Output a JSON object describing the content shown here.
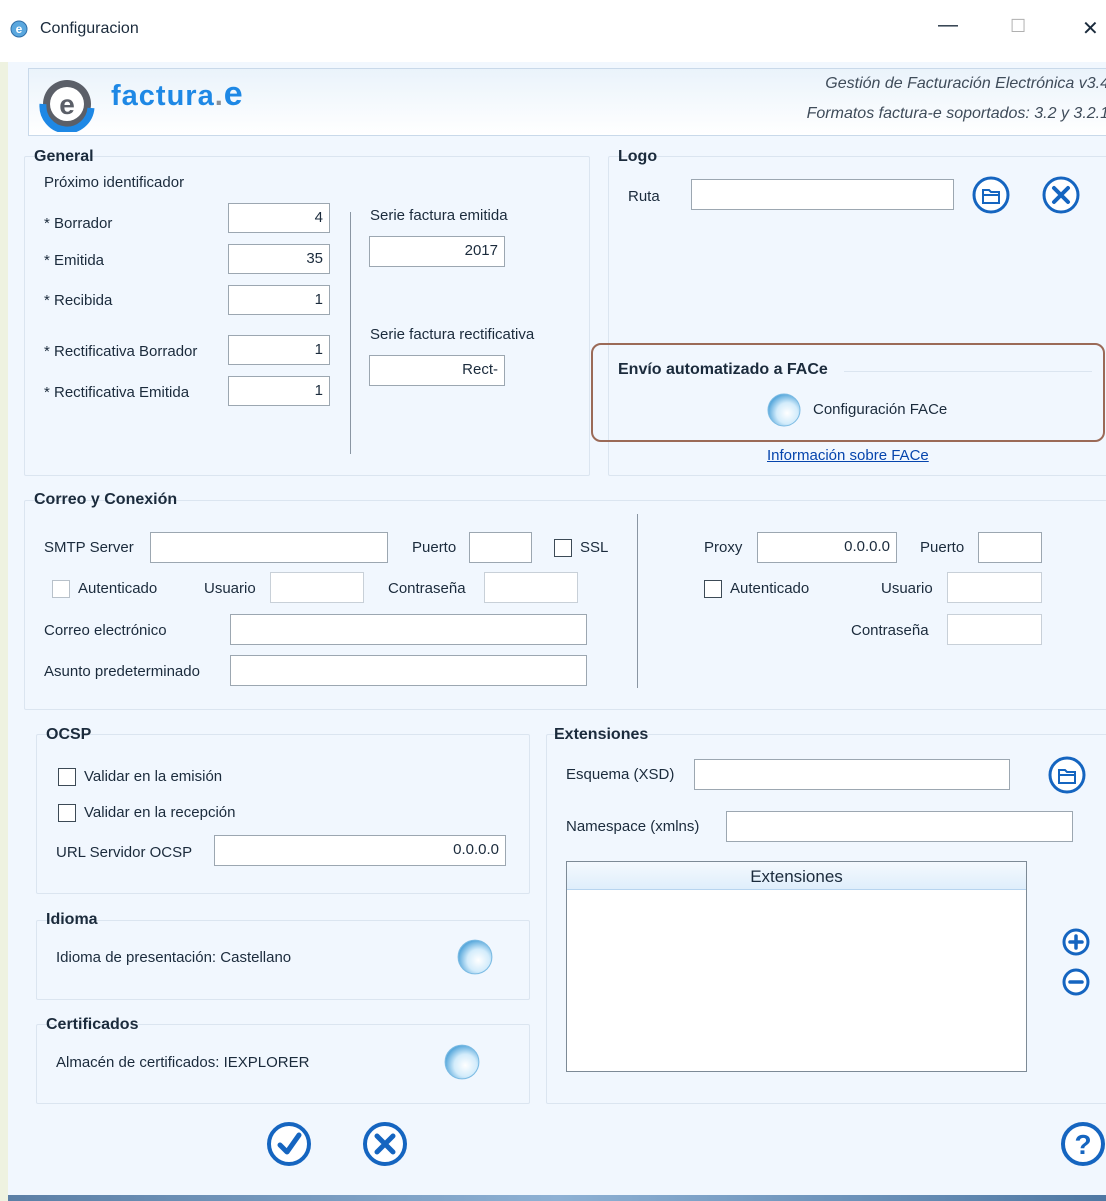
{
  "window": {
    "title": "Configuracion",
    "minimize": "—",
    "maximize": "☐",
    "close": "✕"
  },
  "header": {
    "logo_text": "factura",
    "logo_dot": ".",
    "logo_e": "e",
    "line1": "Gestión de Facturación Electrónica v3.4",
    "line2": "Formatos factura-e soportados: 3.2 y 3.2.1"
  },
  "general": {
    "title": "General",
    "next_id_label": "Próximo identificador",
    "fields": [
      {
        "label": "* Borrador",
        "value": "4"
      },
      {
        "label": "* Emitida",
        "value": "35"
      },
      {
        "label": "* Recibida",
        "value": "1"
      },
      {
        "label": "* Rectificativa Borrador",
        "value": "1"
      },
      {
        "label": "* Rectificativa Emitida",
        "value": "1"
      }
    ],
    "serie_emitida_label": "Serie factura emitida",
    "serie_emitida_value": "2017",
    "serie_rect_label": "Serie factura rectificativa",
    "serie_rect_value": "Rect-"
  },
  "logo": {
    "title": "Logo",
    "ruta_label": "Ruta",
    "ruta_value": ""
  },
  "face": {
    "title": "Envío automatizado a FACe",
    "config_label": "Configuración FACe",
    "info_link": "Información sobre FACe"
  },
  "correo": {
    "title": "Correo y Conexión",
    "smtp_label": "SMTP Server",
    "smtp_value": "",
    "puerto_label": "Puerto",
    "puerto_value": "",
    "ssl_label": "SSL",
    "autenticado_label": "Autenticado",
    "usuario_label": "Usuario",
    "usuario_value": "",
    "contrasena_label": "Contraseña",
    "contrasena_value": "",
    "correo_label": "Correo electrónico",
    "correo_value": "",
    "asunto_label": "Asunto predeterminado",
    "asunto_value": "",
    "proxy_label": "Proxy",
    "proxy_value": "0.0.0.0",
    "proxy_puerto_label": "Puerto",
    "proxy_puerto_value": "",
    "proxy_autenticado_label": "Autenticado",
    "proxy_usuario_label": "Usuario",
    "proxy_usuario_value": "",
    "proxy_contrasena_label": "Contraseña",
    "proxy_contrasena_value": ""
  },
  "ocsp": {
    "title": "OCSP",
    "validar_emision": "Validar en la emisión",
    "validar_recepcion": "Validar en la recepción",
    "url_label": "URL Servidor OCSP",
    "url_value": "0.0.0.0"
  },
  "idioma": {
    "title": "Idioma",
    "text": "Idioma de presentación: Castellano"
  },
  "certificados": {
    "title": "Certificados",
    "text": "Almacén de certificados: IEXPLORER"
  },
  "extensiones": {
    "title": "Extensiones",
    "esquema_label": "Esquema (XSD)",
    "esquema_value": "",
    "namespace_label": "Namespace (xmlns)",
    "namespace_value": "",
    "list_header": "Extensiones",
    "items": []
  },
  "colors": {
    "accent": "#1565c0",
    "frame_border": "#9b6a57",
    "link": "#0645ad"
  }
}
